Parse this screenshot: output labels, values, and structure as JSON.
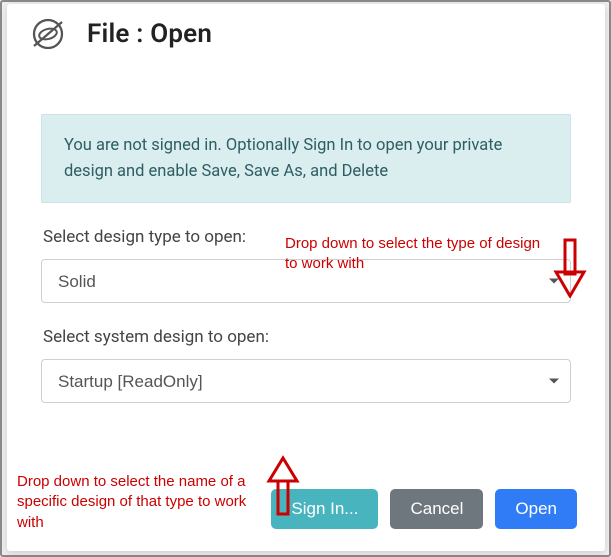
{
  "header": {
    "title": "File : Open"
  },
  "info": {
    "text": "You are not signed in. Optionally Sign In to open your private design and enable Save, Save As, and Delete"
  },
  "design_type": {
    "label": "Select design type to open:",
    "value": "Solid",
    "options": [
      "Solid"
    ]
  },
  "system_design": {
    "label": "Select system design to open:",
    "value": "Startup [ReadOnly]",
    "options": [
      "Startup [ReadOnly]"
    ]
  },
  "buttons": {
    "signin": "Sign In...",
    "cancel": "Cancel",
    "open": "Open"
  },
  "annotations": {
    "type_hint": "Drop down to select the type of design to work with",
    "name_hint": "Drop down to select the name of a  specific design of that type to work with"
  },
  "colors": {
    "info_bg": "#daedef",
    "info_fg": "#2e5d64",
    "primary": "#2f7cf6",
    "teal": "#48b4be",
    "gray": "#6e767e",
    "anno": "#cc0000"
  }
}
